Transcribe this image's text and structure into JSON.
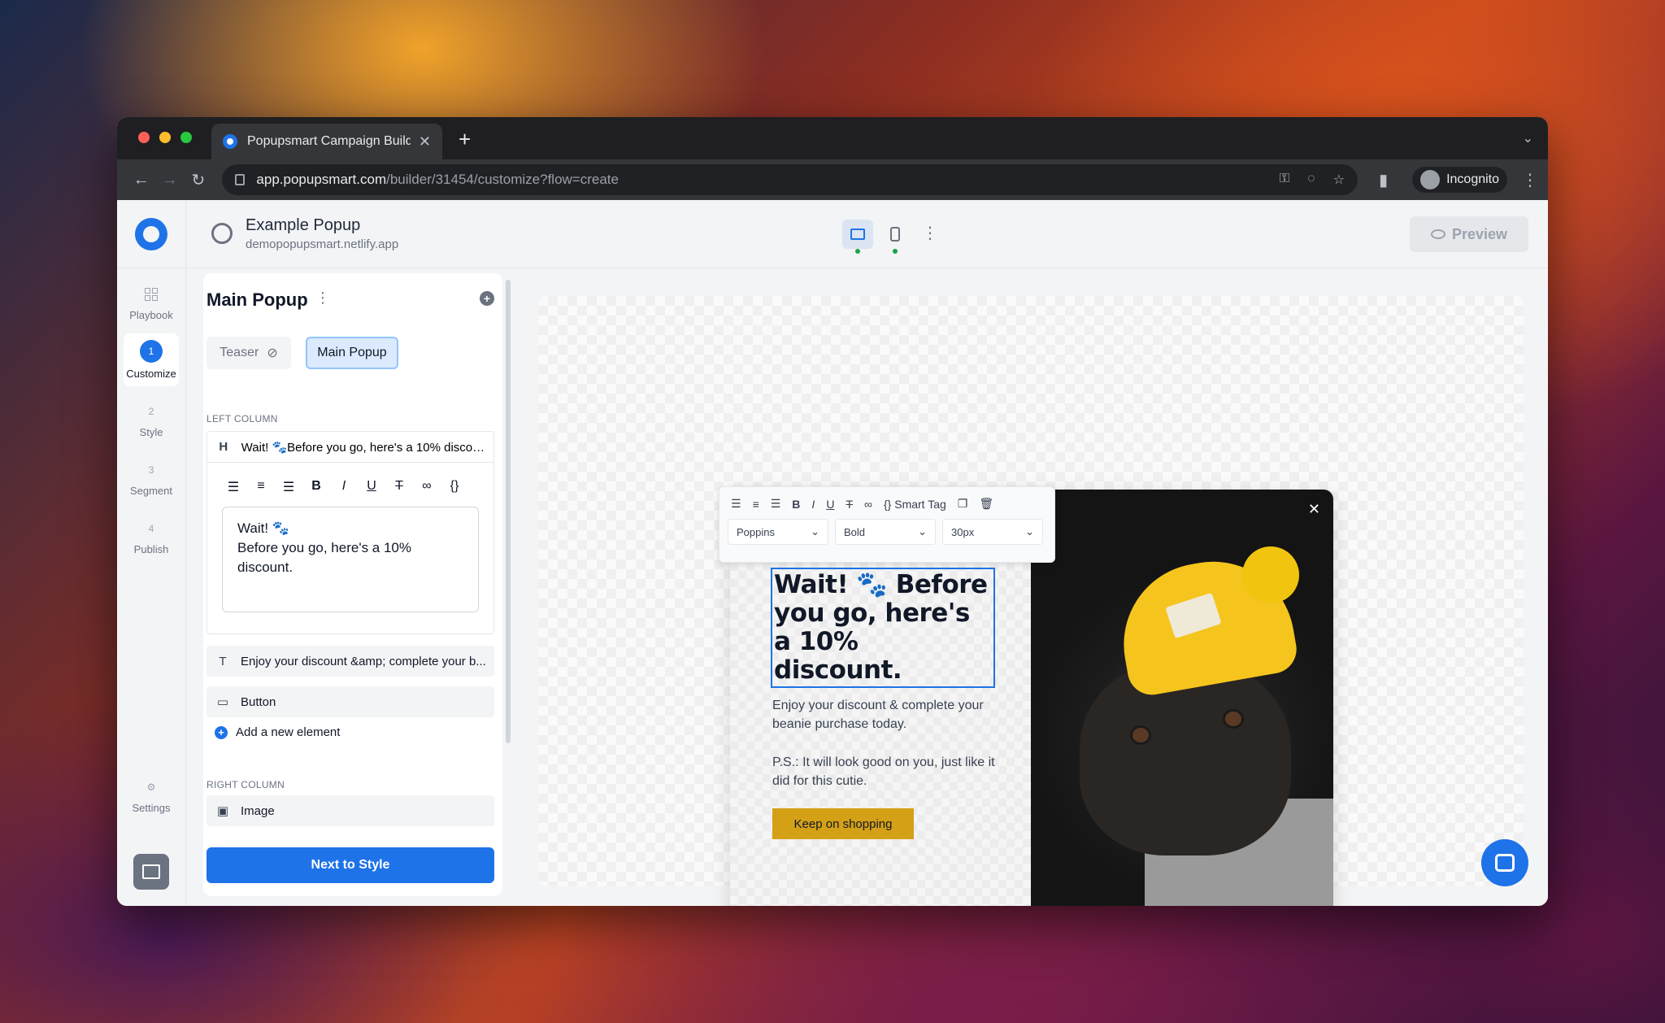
{
  "browser": {
    "tab_title": "Popupsmart Campaign Builder",
    "url_host": "app.popupsmart.com",
    "url_path": "/builder/31454/customize?flow=create",
    "profile_label": "Incognito"
  },
  "header": {
    "site_name": "Example Popup",
    "site_url": "demopopupsmart.netlify.app",
    "preview_label": "Preview"
  },
  "nav": {
    "playbook": "Playbook",
    "steps": [
      {
        "num": "1",
        "label": "Customize"
      },
      {
        "num": "2",
        "label": "Style"
      },
      {
        "num": "3",
        "label": "Segment"
      },
      {
        "num": "4",
        "label": "Publish"
      }
    ],
    "settings": "Settings"
  },
  "panel": {
    "title": "Main Popup",
    "teaser_label": "Teaser",
    "main_label": "Main Popup",
    "left_column_label": "LEFT COLUMN",
    "heading_tag": "H",
    "heading_text": "Wait! 🐾Before you go, here's a 10% discou...",
    "textbox_line1": "Wait! 🐾",
    "textbox_line2": "Before you go, here's a 10% discount.",
    "text_tag": "T",
    "text_element": "Enjoy your discount &amp; complete your b...",
    "button_element": "Button",
    "add_element": "Add a new element",
    "right_column_label": "RIGHT COLUMN",
    "image_element": "Image",
    "next_button": "Next to Style"
  },
  "text_toolbar": {
    "smart_tag": "Smart Tag",
    "font": "Poppins",
    "weight": "Bold",
    "size": "30px"
  },
  "popup": {
    "headline": "Wait! 🐾 Before you go, here's a 10% discount.",
    "body1": "Enjoy your discount & complete your beanie purchase today.",
    "body2": "P.S.: It will look good on you, just like it did for this cutie.",
    "button": "Keep on shopping"
  },
  "colors": {
    "accent": "#1e73e8",
    "cta": "#d4a016"
  }
}
